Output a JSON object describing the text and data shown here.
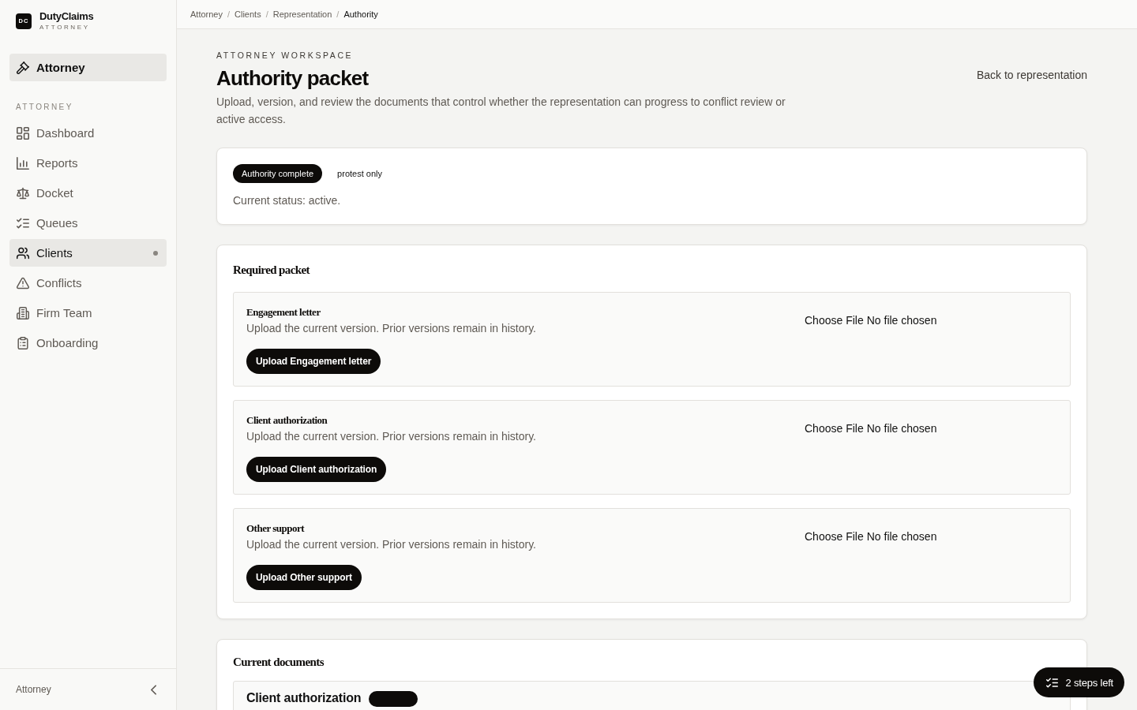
{
  "brand": {
    "logo": "DC",
    "name": "DutyClaims",
    "subtitle": "ATTORNEY"
  },
  "role_switcher": {
    "label": "Attorney"
  },
  "sidebar": {
    "section_label": "ATTORNEY",
    "items": [
      {
        "label": "Dashboard",
        "selected": false,
        "indicator": false
      },
      {
        "label": "Reports",
        "selected": false,
        "indicator": false
      },
      {
        "label": "Docket",
        "selected": false,
        "indicator": false
      },
      {
        "label": "Queues",
        "selected": false,
        "indicator": false
      },
      {
        "label": "Clients",
        "selected": true,
        "indicator": true
      },
      {
        "label": "Conflicts",
        "selected": false,
        "indicator": false
      },
      {
        "label": "Firm Team",
        "selected": false,
        "indicator": false
      },
      {
        "label": "Onboarding",
        "selected": false,
        "indicator": false
      }
    ]
  },
  "sidebar_footer": {
    "label": "Attorney"
  },
  "breadcrumb": {
    "separator": "/",
    "items": [
      {
        "label": "Attorney",
        "current": false
      },
      {
        "label": "Clients",
        "current": false
      },
      {
        "label": "Representation",
        "current": false
      },
      {
        "label": "Authority",
        "current": true
      }
    ]
  },
  "header": {
    "eyebrow": "ATTORNEY WORKSPACE",
    "title": "Authority packet",
    "description": "Upload, version, and review the documents that control whether the representation can progress to conflict review or active access.",
    "back_link": "Back to representation"
  },
  "status_card": {
    "badges": [
      {
        "label": "Authority complete",
        "kind": "filled"
      },
      {
        "label": "protest only",
        "kind": "plain"
      }
    ],
    "text": "Current status: active."
  },
  "required_packet": {
    "title": "Required packet",
    "items": [
      {
        "title": "Engagement letter",
        "description": "Upload the current version. Prior versions remain in history.",
        "button": "Upload Engagement letter",
        "file_button": "Choose File",
        "file_status": "No file chosen"
      },
      {
        "title": "Client authorization",
        "description": "Upload the current version. Prior versions remain in history.",
        "button": "Upload Client authorization",
        "file_button": "Choose File",
        "file_status": "No file chosen"
      },
      {
        "title": "Other support",
        "description": "Upload the current version. Prior versions remain in history.",
        "button": "Upload Other support",
        "file_button": "Choose File",
        "file_status": "No file chosen"
      }
    ]
  },
  "current_documents": {
    "title": "Current documents",
    "items": [
      {
        "title": "Client authorization",
        "badge_shown": true
      }
    ]
  },
  "steps_button": {
    "label": "2 steps left"
  }
}
